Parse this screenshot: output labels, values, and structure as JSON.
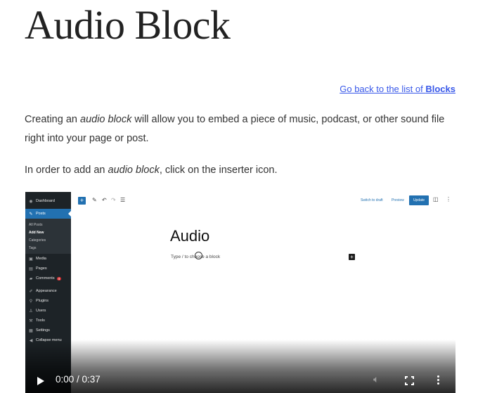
{
  "page": {
    "title": "Audio Block",
    "back_link_prefix": "Go back to the list of ",
    "back_link_bold": "Blocks",
    "p1_a": "Creating an ",
    "p1_em": "audio block",
    "p1_b": " will allow you to embed a piece of music, podcast, or other sound file right into your page or post.",
    "p2_a": "In order to add an ",
    "p2_em": "audio block",
    "p2_b": ", click on the inserter icon."
  },
  "wp": {
    "sidebar": {
      "dashboard": "Dashboard",
      "posts": "Posts",
      "all_posts": "All Posts",
      "add_new": "Add New",
      "categories": "Categories",
      "tags": "Tags",
      "media": "Media",
      "pages": "Pages",
      "comments": "Comments",
      "comments_badge": "4",
      "appearance": "Appearance",
      "plugins": "Plugins",
      "users": "Users",
      "tools": "Tools",
      "settings": "Settings",
      "collapse": "Collapse menu"
    },
    "toolbar": {
      "switch_draft": "Switch to draft",
      "preview": "Preview",
      "update": "Update"
    },
    "editor": {
      "title": "Audio",
      "placeholder": "Type / to choose a block"
    }
  },
  "player": {
    "time": "0:00 / 0:37"
  },
  "icons": {
    "play": "play-icon",
    "volume": "volume-icon",
    "fullscreen": "fullscreen-icon",
    "more": "more-options-icon"
  }
}
